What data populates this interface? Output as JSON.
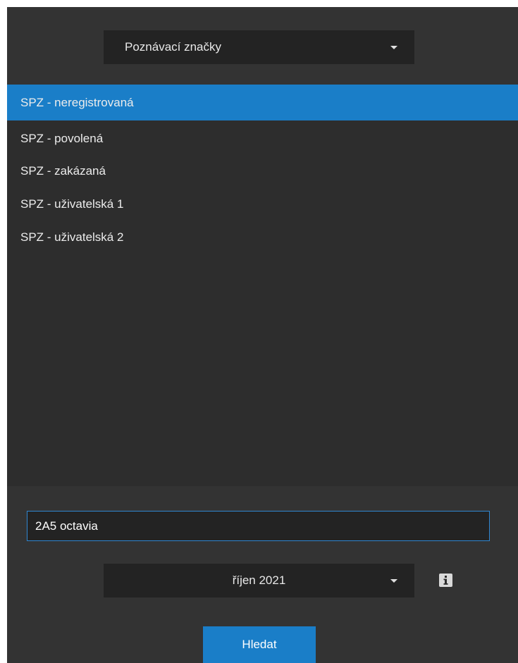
{
  "category_select": {
    "selected": "Poznávací značky",
    "icon": "chevron-down-icon"
  },
  "list": {
    "items": [
      {
        "label": "SPZ - neregistrovaná",
        "selected": true
      },
      {
        "label": "SPZ - povolená",
        "selected": false
      },
      {
        "label": "SPZ - zakázaná",
        "selected": false
      },
      {
        "label": "SPZ - uživatelská 1",
        "selected": false
      },
      {
        "label": "SPZ - uživatelská 2",
        "selected": false
      }
    ]
  },
  "search": {
    "value": "2A5 octavia"
  },
  "month_select": {
    "selected": "říjen 2021",
    "icon": "chevron-down-icon"
  },
  "info": {
    "icon": "info-icon"
  },
  "search_button": {
    "label": "Hledat"
  },
  "colors": {
    "accent": "#1a7ec8",
    "background": "#2d2d2d",
    "panel": "#333333",
    "control": "#232323"
  }
}
